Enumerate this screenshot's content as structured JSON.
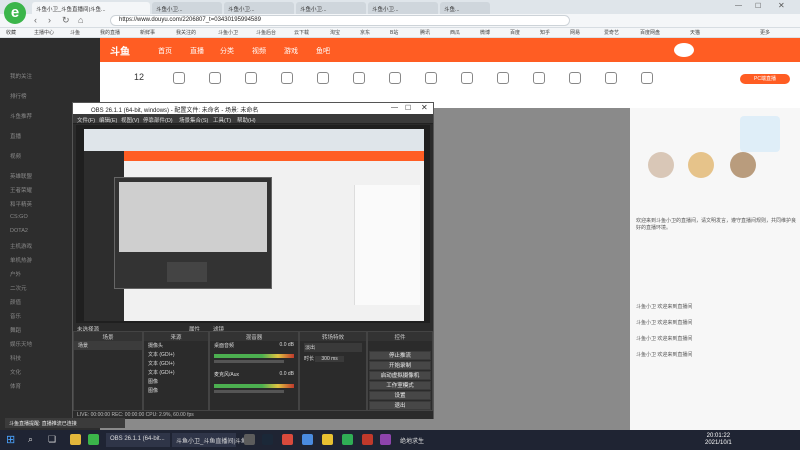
{
  "browser": {
    "url": "https://www.douyu.com/2206807_t=03430195994589",
    "tabs": [
      {
        "label": "斗鱼小卫_斗鱼直播间|斗鱼..."
      },
      {
        "label": "斗鱼小卫..."
      },
      {
        "label": "斗鱼小卫..."
      },
      {
        "label": "斗鱼小卫..."
      },
      {
        "label": "斗鱼小卫..."
      },
      {
        "label": "斗鱼..."
      }
    ],
    "bookmarks": [
      "收藏",
      "主播中心",
      "斗鱼",
      "我的直播",
      "新鲜事",
      "我关注的",
      "斗鱼小卫",
      "斗鱼后台",
      "云下载",
      "淘宝",
      "京东",
      "B站",
      "腾讯",
      "西瓜",
      "微博",
      "百度",
      "知乎",
      "网易",
      "爱奇艺",
      "百度网盘",
      "天猫",
      "更多"
    ]
  },
  "douyu": {
    "logo_text": "斗鱼",
    "nav": [
      "首页",
      "直播",
      "分类",
      "视频",
      "游戏",
      "鱼吧"
    ],
    "categories": [
      "12",
      "",
      "",
      "",
      "",
      "",
      "",
      "",
      "",
      "",
      "",
      "",
      "",
      "",
      "",
      ""
    ],
    "sidebar": [
      "我的关注",
      "排行榜",
      "斗鱼推荐",
      "直播",
      "视频",
      "英雄联盟",
      "王者荣耀",
      "和平精英",
      "CS:GO",
      "DOTA2",
      "主机游戏",
      "单机热游",
      "户外",
      "二次元",
      "颜值",
      "音乐",
      "舞蹈",
      "娱乐天地",
      "科技",
      "文化",
      "体育"
    ],
    "chat": [
      "欢迎来到斗鱼小卫的直播间，请文明发言，遵守直播间规则，共同维护良好的直播环境。",
      "斗鱼小卫 欢迎来到直播间",
      "斗鱼小卫 欢迎来到直播间",
      "斗鱼小卫 欢迎来到直播间",
      "斗鱼小卫 欢迎来到直播间"
    ],
    "badge_text": "PC端直播"
  },
  "obs": {
    "title": "OBS 26.1.1 (64-bit, windows) - 配置文件: 未命名 - 场景: 未命名",
    "menu": [
      "文件(F)",
      "编辑(E)",
      "视图(V)",
      "停靠部件(D)",
      "场景集合(S)",
      "工具(T)",
      "帮助(H)"
    ],
    "no_source": "未选择源",
    "btn_props": "属性",
    "btn_filters": "滤镜",
    "panels": {
      "scenes": "场景",
      "sources": "来源",
      "mixer": "混音器",
      "transitions": "转场特效",
      "controls": "控件"
    },
    "scene_items": [
      "场景"
    ],
    "source_items": [
      "摄像头",
      "文本 (GDI+)",
      "文本 (GDI+)",
      "文本 (GDI+)",
      "图像",
      "图像"
    ],
    "mixer_tracks": [
      {
        "name": "桌面音频",
        "level": "0.0 dB"
      },
      {
        "name": "麦克风/Aux",
        "level": "0.0 dB"
      }
    ],
    "transition": "淡出",
    "duration_label": "时长",
    "duration": "300 ms",
    "controls": [
      "停止推流",
      "开始录制",
      "启动虚拟摄像机",
      "工作室模式",
      "设置",
      "退出"
    ],
    "status": "LIVE: 00:00:00   REC: 00:00:00   CPU: 2.9%, 60.00 fps"
  },
  "notification": "斗鱼直播提醒: 直播推流已连接",
  "taskbar": {
    "items": [
      "OBS 26.1.1 (64-bit...",
      "斗鱼小卫_斗鱼直播间|斗鱼...",
      "绝地求生"
    ],
    "time": "20:01:22",
    "date": "2021/10/1"
  },
  "colors": {
    "douyu_orange": "#ff5d23",
    "obs_bg": "#2b2b2b",
    "taskbar": "#1f2433"
  }
}
